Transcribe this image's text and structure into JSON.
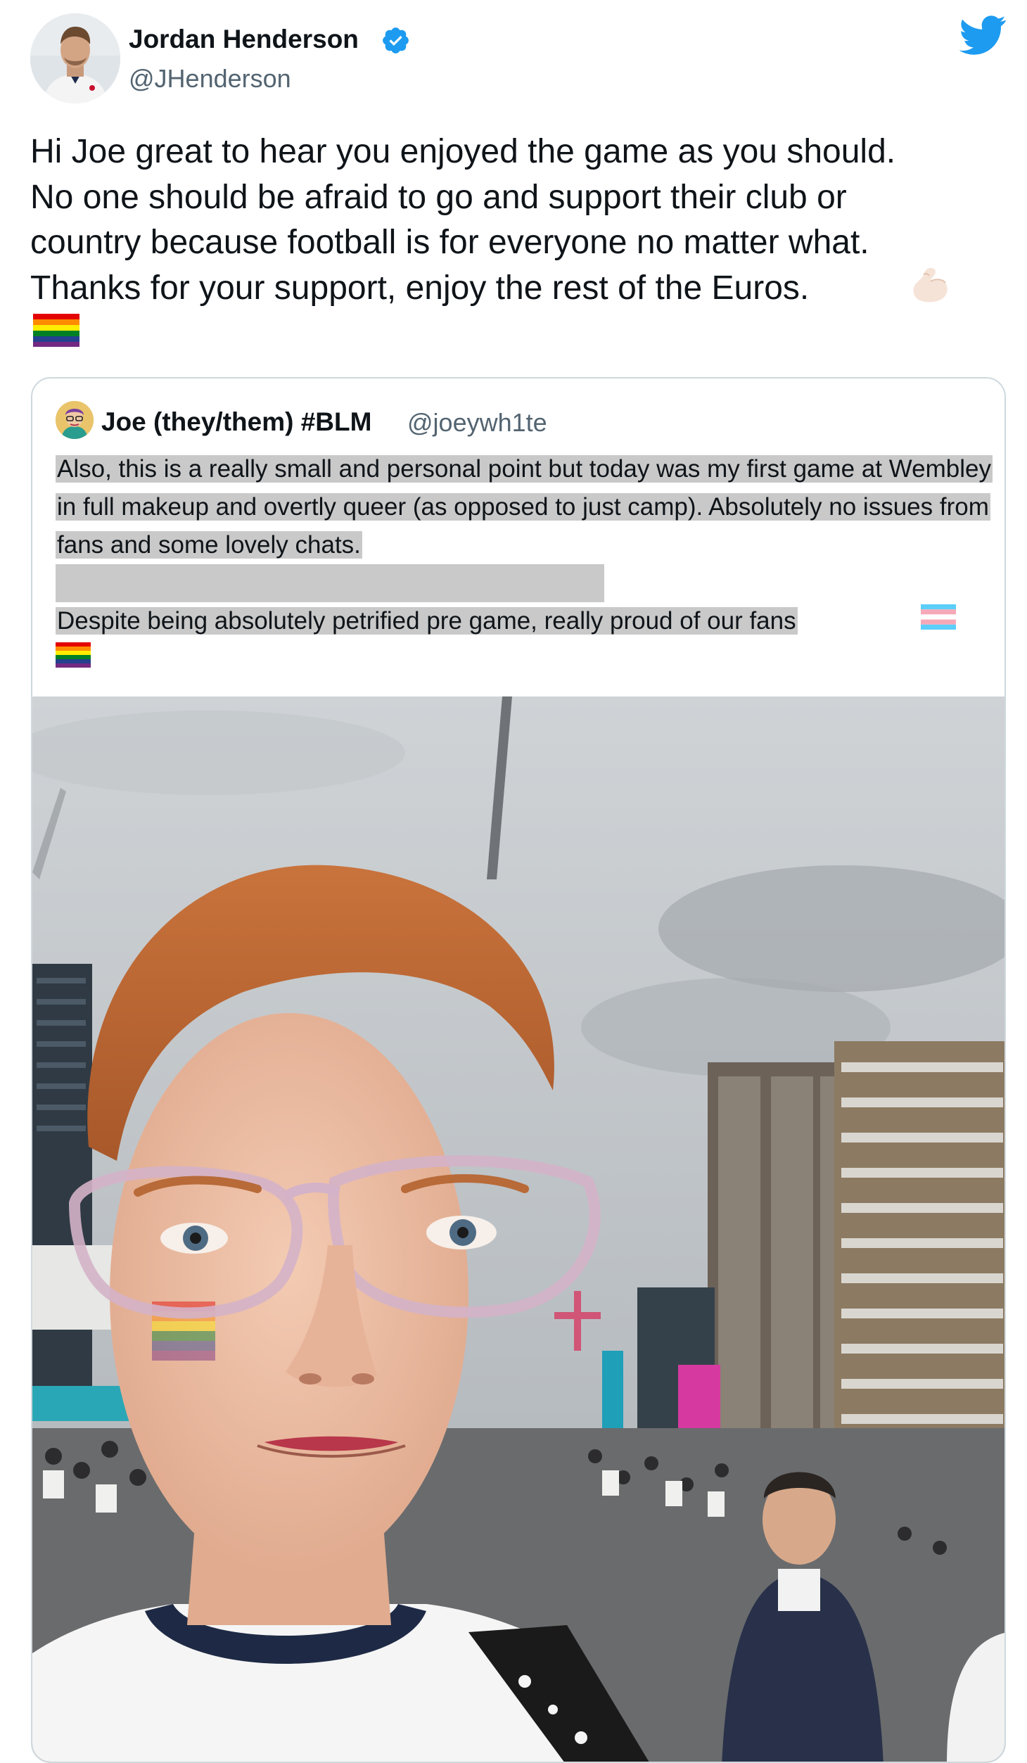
{
  "tweet": {
    "author_name": "Jordan Henderson",
    "author_handle": "@JHenderson",
    "verified": true,
    "text": "Hi Joe great to hear you enjoyed the game as you should.\nNo one should be afraid to go and support their club or\ncountry because football is for everyone no matter what.\nThanks for your support, enjoy the rest of the Euros.",
    "emojis": [
      "flexed-biceps-icon",
      "rainbow-flag-icon"
    ]
  },
  "quoted_tweet": {
    "author_name": "Joe (they/them) #BLM",
    "author_handle": "@joeywh1te",
    "paragraph_1": "Also, this is a really small and personal point but today was my first game at Wembley in full makeup and overtly queer (as opposed to just camp). Absolutely no issues from fans and some lovely chats.",
    "paragraph_2": "Despite being absolutely petrified pre game, really proud of our fans",
    "emojis": [
      "transgender-flag-icon",
      "rainbow-flag-icon"
    ],
    "media": "selfie-photo"
  },
  "colors": {
    "twitter_blue": "#1d9bf0",
    "text": "#0f1419",
    "secondary_text": "#536471",
    "card_border": "#cfd9de",
    "selection_highlight": "#c9c9c9"
  }
}
